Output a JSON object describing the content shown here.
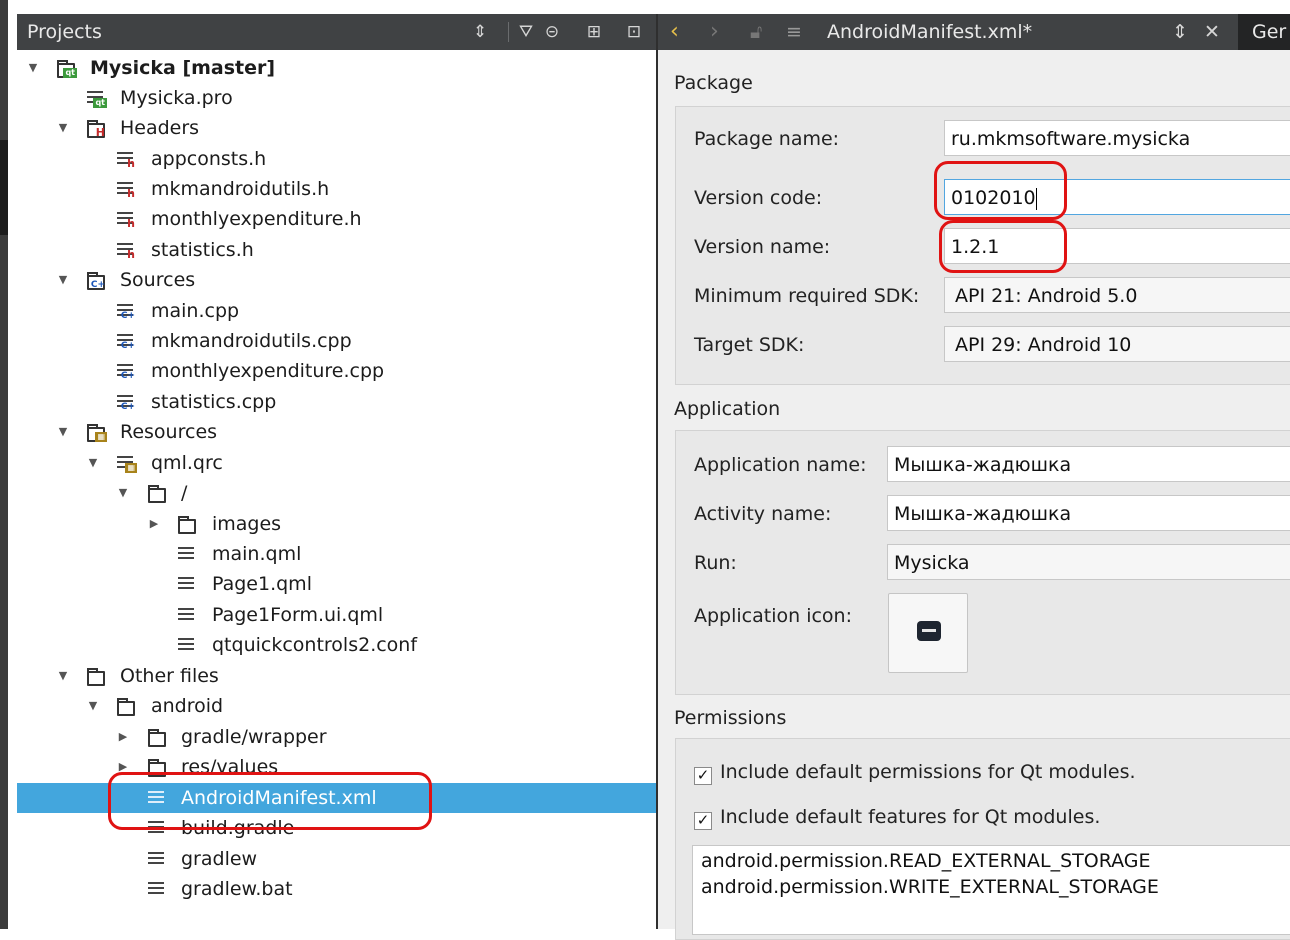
{
  "projects_pane": {
    "title": "Projects",
    "toolbar": [
      {
        "name": "sort-updown-icon",
        "glyph": "⇕"
      },
      {
        "name": "filter-icon",
        "glyph": "⛛"
      },
      {
        "name": "link-icon",
        "glyph": "⊝"
      },
      {
        "name": "split-icon",
        "glyph": "⊞"
      },
      {
        "name": "close-pane-icon",
        "glyph": "⊡"
      }
    ]
  },
  "tree": {
    "project": "Mysicka [master]",
    "pro_file": "Mysicka.pro",
    "headers": {
      "label": "Headers",
      "files": [
        "appconsts.h",
        "mkmandroidutils.h",
        "monthlyexpenditure.h",
        "statistics.h"
      ]
    },
    "sources": {
      "label": "Sources",
      "files": [
        "main.cpp",
        "mkmandroidutils.cpp",
        "monthlyexpenditure.cpp",
        "statistics.cpp"
      ]
    },
    "resources": {
      "label": "Resources",
      "qrc": "qml.qrc",
      "root": "/",
      "images": "images",
      "qml_files": [
        "main.qml",
        "Page1.qml",
        "Page1Form.ui.qml"
      ],
      "conf": "qtquickcontrols2.conf"
    },
    "other": {
      "label": "Other files",
      "android": "android",
      "dirs": [
        "gradle/wrapper",
        "res/values"
      ],
      "files": [
        "AndroidManifest.xml",
        "build.gradle",
        "gradlew",
        "gradlew.bat"
      ]
    }
  },
  "editor": {
    "header": {
      "file": "AndroidManifest.xml*",
      "tab": "Ger"
    },
    "package": {
      "title": "Package",
      "package_name_label": "Package name:",
      "package_name": "ru.mkmsoftware.mysicka",
      "version_code_label": "Version code:",
      "version_code": "0102010",
      "version_name_label": "Version name:",
      "version_name": "1.2.1",
      "min_sdk_label": "Minimum required SDK:",
      "min_sdk": "API 21: Android 5.0",
      "target_sdk_label": "Target SDK:",
      "target_sdk": "API 29: Android 10"
    },
    "application": {
      "title": "Application",
      "app_name_label": "Application name:",
      "app_name": "Мышка-жадюшка",
      "activity_label": "Activity name:",
      "activity": "Мышка-жадюшка",
      "run_label": "Run:",
      "run": "Mysicka",
      "icon_label": "Application icon:"
    },
    "permissions": {
      "title": "Permissions",
      "include_perms": "Include default permissions for Qt modules.",
      "include_features": "Include default features for Qt modules.",
      "list": [
        "android.permission.READ_EXTERNAL_STORAGE",
        "android.permission.WRITE_EXTERNAL_STORAGE"
      ]
    }
  }
}
